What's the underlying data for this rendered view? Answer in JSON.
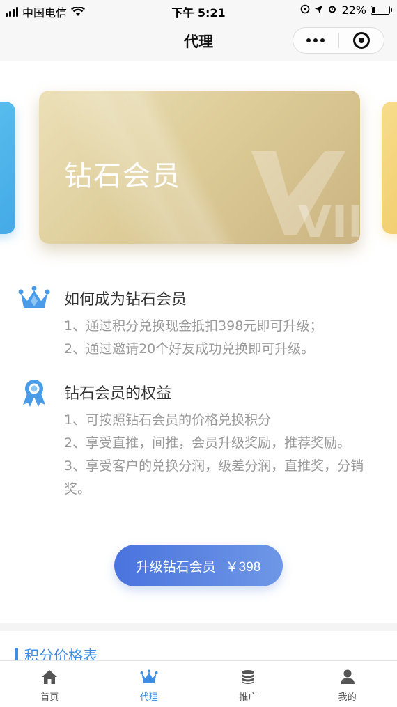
{
  "status_bar": {
    "carrier": "中国电信",
    "time": "下午 5:21",
    "battery": "22%",
    "battery_level": 0.22
  },
  "nav": {
    "title": "代理"
  },
  "card": {
    "title": "钻石会员",
    "watermark": "VIP"
  },
  "how_to": {
    "title": "如何成为钻石会员",
    "lines": [
      "1、通过积分兑换现金抵扣398元即可升级；",
      "2、通过邀请20个好友成功兑换即可升级。"
    ]
  },
  "benefits": {
    "title": "钻石会员的权益",
    "lines": [
      "1、可按照钻石会员的价格兑换积分",
      "2、享受直推，间推，会员升级奖励，推荐奖励。",
      "3、享受客户的兑换分润，级差分润，直推奖，分销奖。"
    ]
  },
  "upgrade": {
    "label": "升级钻石会员",
    "price": "￥398"
  },
  "price_table": {
    "title": "积分价格表"
  },
  "tabs": [
    {
      "label": "首页",
      "icon": "home-icon",
      "active": false
    },
    {
      "label": "代理",
      "icon": "crown-icon",
      "active": true
    },
    {
      "label": "推广",
      "icon": "coins-icon",
      "active": false
    },
    {
      "label": "我的",
      "icon": "user-icon",
      "active": false
    }
  ],
  "colors": {
    "accent": "#3f8ee6",
    "button_start": "#4a74de",
    "button_end": "#6f97e6",
    "card_gold": "#dccb96",
    "icon_blue": "#4a9be8"
  }
}
